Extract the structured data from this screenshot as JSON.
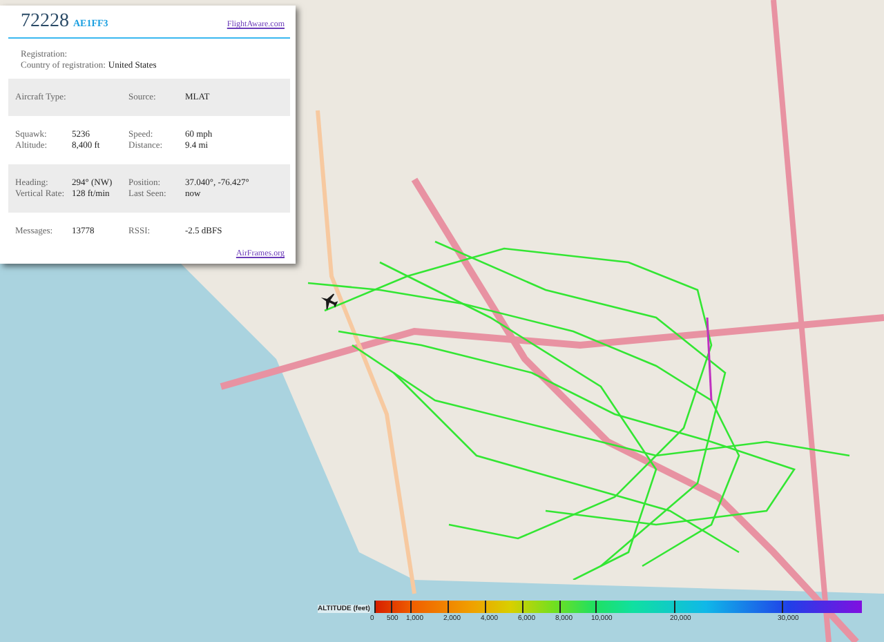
{
  "popup": {
    "title": "72228",
    "hex": "AE1FF3",
    "top_link": "FlightAware.com",
    "registration_label": "Registration:",
    "country_label": "Country of registration:",
    "country": "United States",
    "sections": [
      {
        "shaded": true,
        "rows": [
          {
            "label_1": "Aircraft Type:",
            "label_2": "Source:",
            "value_2": "MLAT"
          }
        ]
      },
      {
        "shaded": false,
        "rows": [
          {
            "label_1": "Squawk:",
            "value_1": "5236",
            "label_2": "Speed:",
            "value_2": "60 mph"
          },
          {
            "label_1": "Altitude:",
            "value_1": "8,400 ft",
            "label_2": "Distance:",
            "value_2": "9.4 mi"
          }
        ]
      },
      {
        "shaded": true,
        "rows": [
          {
            "label_1": "Heading:",
            "value_1": "294° (NW)",
            "label_2": "Position:",
            "value_2": "37.040°, -76.427°"
          },
          {
            "label_1": "Vertical Rate:",
            "value_1": "128 ft/min",
            "label_2": "Last Seen:",
            "value_2": "now"
          }
        ]
      },
      {
        "shaded": false,
        "rows": [
          {
            "label_1": "Messages:",
            "value_1": "13778",
            "label_2": "RSSI:",
            "value_2": "-2.5 dBFS"
          }
        ]
      }
    ],
    "bottom_link": "AirFrames.org"
  },
  "legend": {
    "title": "ALTITUDE (feet)",
    "ticks": [
      "0",
      "500",
      "1,000",
      "2,000",
      "4,000",
      "6,000",
      "8,000",
      "10,000",
      "20,000",
      "30,000"
    ]
  }
}
